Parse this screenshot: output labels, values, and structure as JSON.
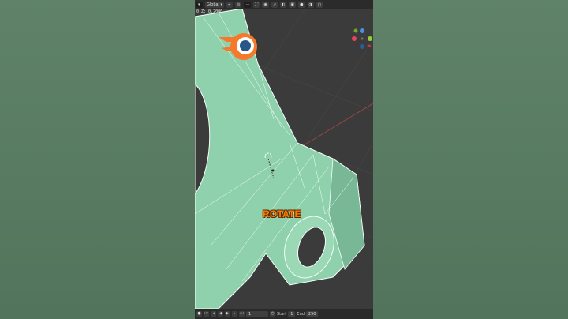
{
  "header": {
    "transform_orientation": "Global",
    "coord_readout": "0 Z: 0.2000"
  },
  "overlay": {
    "rotate_label": "ROTATE"
  },
  "timeline": {
    "current_frame": "1",
    "start_label": "Start",
    "start_value": "1",
    "end_label": "End",
    "end_value": "250"
  },
  "colors": {
    "mesh_fill": "#8fd1ad",
    "mesh_wire": "#f4fff8",
    "rotate_text": "#ff7a00",
    "blender_orange": "#f5792a",
    "blender_blue": "#265787"
  }
}
